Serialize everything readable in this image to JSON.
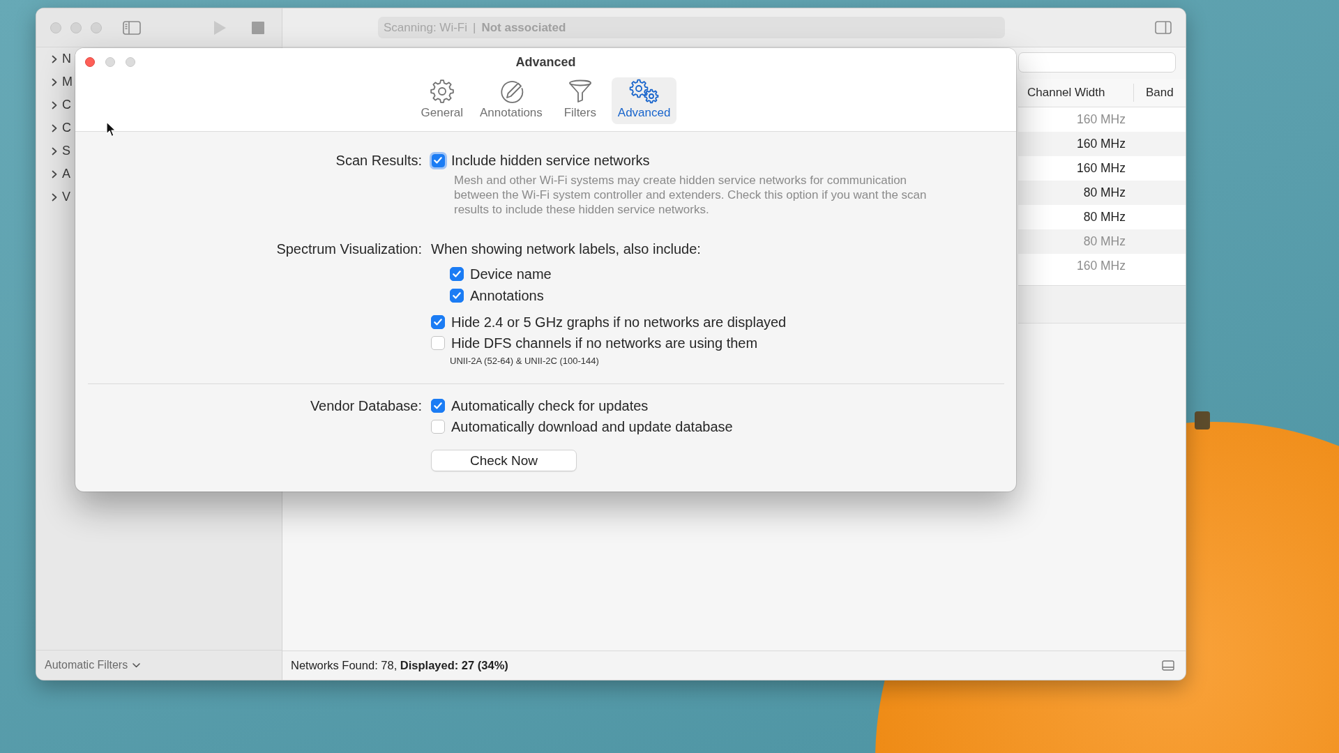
{
  "main_window": {
    "toolbar": {
      "status": "Scanning: Wi-Fi",
      "separator": "|",
      "connection": "Not associated"
    },
    "sidebar": {
      "items": [
        {
          "label": "N",
          "expanded": false
        },
        {
          "label": "M",
          "expanded": false
        },
        {
          "label": "C",
          "expanded": false
        },
        {
          "label": "C",
          "expanded": false
        },
        {
          "label": "S",
          "expanded": false
        },
        {
          "label": "A",
          "expanded": false
        },
        {
          "label": "V",
          "expanded": false
        }
      ],
      "filter_menu": "Automatic Filters"
    },
    "table": {
      "columns": [
        "Channel Width",
        "Band"
      ],
      "rows": [
        {
          "channel_width": "160 MHz",
          "dimmed": true
        },
        {
          "channel_width": "160 MHz",
          "dimmed": false
        },
        {
          "channel_width": "160 MHz",
          "dimmed": false
        },
        {
          "channel_width": "80 MHz",
          "dimmed": false
        },
        {
          "channel_width": "80 MHz",
          "dimmed": false
        },
        {
          "channel_width": "80 MHz",
          "dimmed": true
        },
        {
          "channel_width": "160 MHz",
          "dimmed": true
        }
      ]
    },
    "status_bar": "Networks Found: 78, **Displayed: 27 (34%)**"
  },
  "preferences": {
    "title": "Advanced",
    "tabs": [
      {
        "label": "General",
        "selected": false
      },
      {
        "label": "Annotations",
        "selected": false
      },
      {
        "label": "Filters",
        "selected": false
      },
      {
        "label": "Advanced",
        "selected": true
      }
    ],
    "scan_results": {
      "label": "Scan Results:",
      "option": {
        "label": "Include hidden service networks",
        "checked": true,
        "focused": true
      },
      "description": "Mesh and other Wi-Fi systems may create hidden service networks for communication between the Wi-Fi system controller and extenders. Check this option if you want the scan results to include these hidden service networks."
    },
    "spectrum_visualization": {
      "label": "Spectrum Visualization:",
      "intro": "When showing network labels, also include:",
      "label_options": [
        {
          "label": "Device name",
          "checked": true
        },
        {
          "label": "Annotations",
          "checked": true
        }
      ],
      "options": [
        {
          "label": "Hide 2.4 or 5 GHz graphs if no networks are displayed",
          "checked": true
        },
        {
          "label": "Hide DFS channels if no networks are using them",
          "checked": false
        }
      ],
      "note": "UNII-2A (52-64) & UNII-2C (100-144)"
    },
    "vendor_database": {
      "label": "Vendor Database:",
      "options": [
        {
          "label": "Automatically check for updates",
          "checked": true
        },
        {
          "label": "Automatically download and update database",
          "checked": false
        }
      ],
      "button": "Check Now"
    }
  }
}
